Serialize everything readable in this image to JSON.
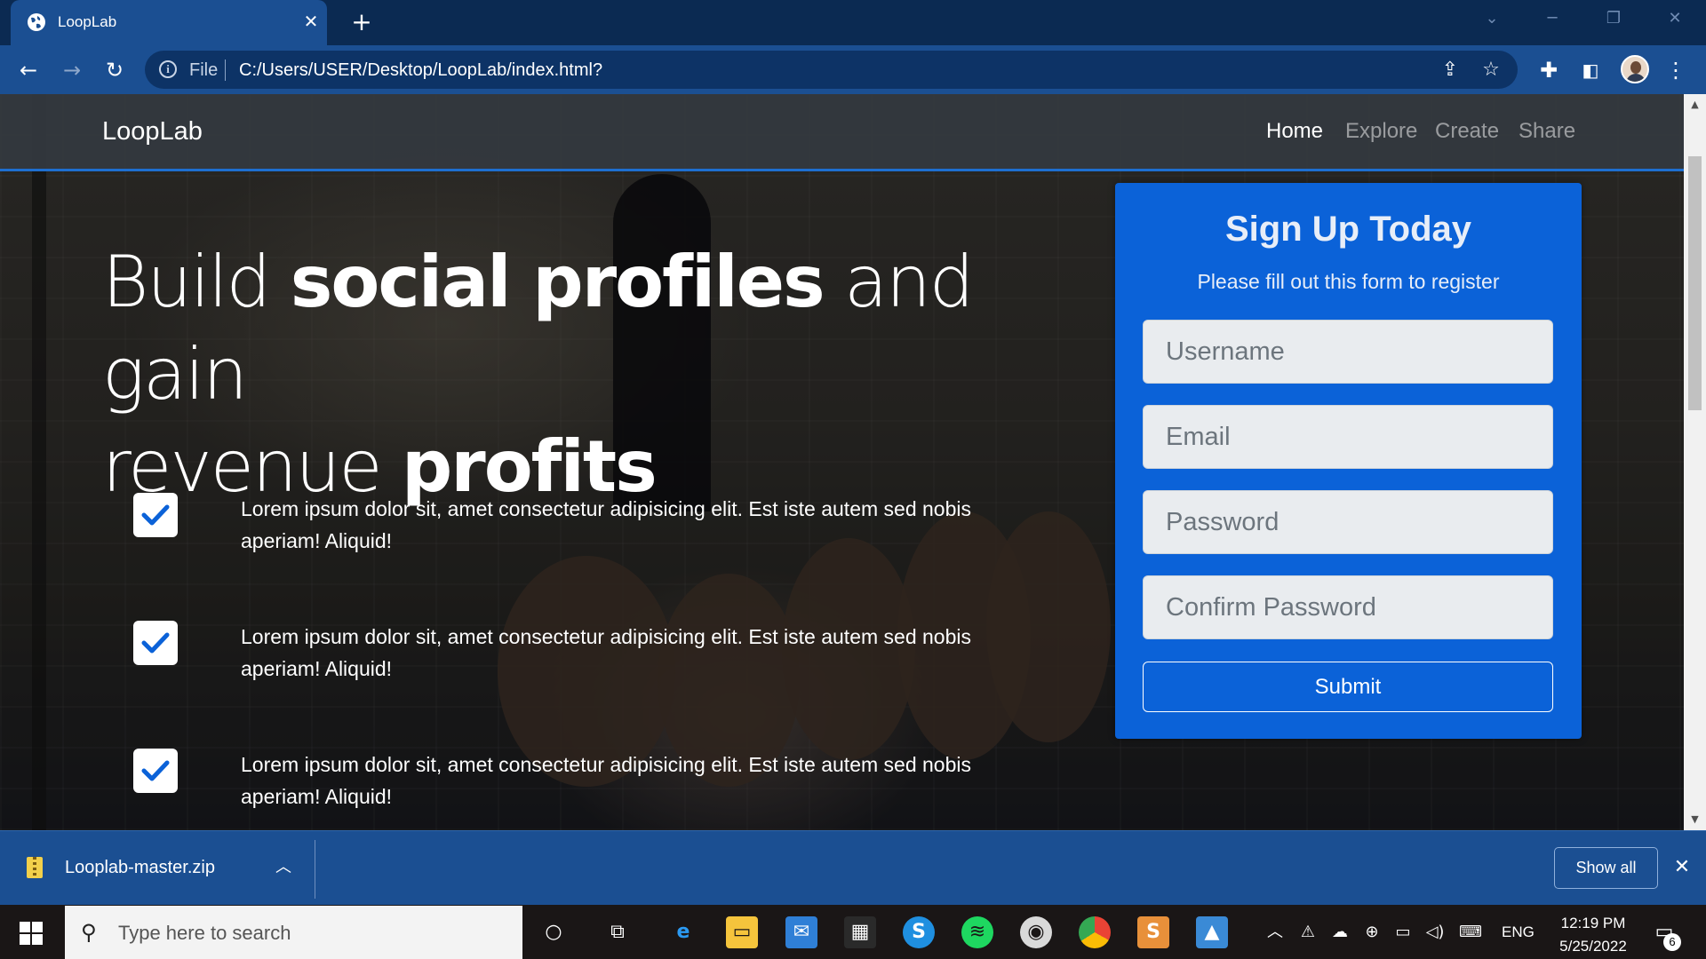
{
  "browser": {
    "tab_title": "LoopLab",
    "url_scheme": "File",
    "url": "C:/Users/USER/Desktop/LoopLab/index.html?"
  },
  "site": {
    "brand": "LoopLab",
    "nav": [
      {
        "label": "Home",
        "active": true
      },
      {
        "label": "Explore",
        "active": false
      },
      {
        "label": "Create",
        "active": false
      },
      {
        "label": "Share",
        "active": false
      }
    ],
    "hero": {
      "line1_light": "Build ",
      "line1_bold": "social profiles",
      "line1_light2": " and gain",
      "line2_light": "revenue ",
      "line2_bold": "profits"
    },
    "features": [
      "Lorem ipsum dolor sit, amet consectetur adipisicing elit. Est iste autem sed nobis aperiam! Aliquid!",
      "Lorem ipsum dolor sit, amet consectetur adipisicing elit. Est iste autem sed nobis aperiam! Aliquid!",
      "Lorem ipsum dolor sit, amet consectetur adipisicing elit. Est iste autem sed nobis aperiam! Aliquid!"
    ],
    "signup": {
      "title": "Sign Up Today",
      "subtitle": "Please fill out this form to register",
      "username_placeholder": "Username",
      "email_placeholder": "Email",
      "password_placeholder": "Password",
      "confirm_placeholder": "Confirm Password",
      "submit_label": "Submit"
    }
  },
  "download_shelf": {
    "file_name": "Looplab-master.zip",
    "show_all_label": "Show all"
  },
  "taskbar": {
    "search_placeholder": "Type here to search",
    "language": "ENG",
    "time": "12:19 PM",
    "date": "5/25/2022",
    "notification_count": "6"
  },
  "colors": {
    "accent": "#0b62d8",
    "chrome": "#1b4f92",
    "navbar": "#343a40"
  }
}
